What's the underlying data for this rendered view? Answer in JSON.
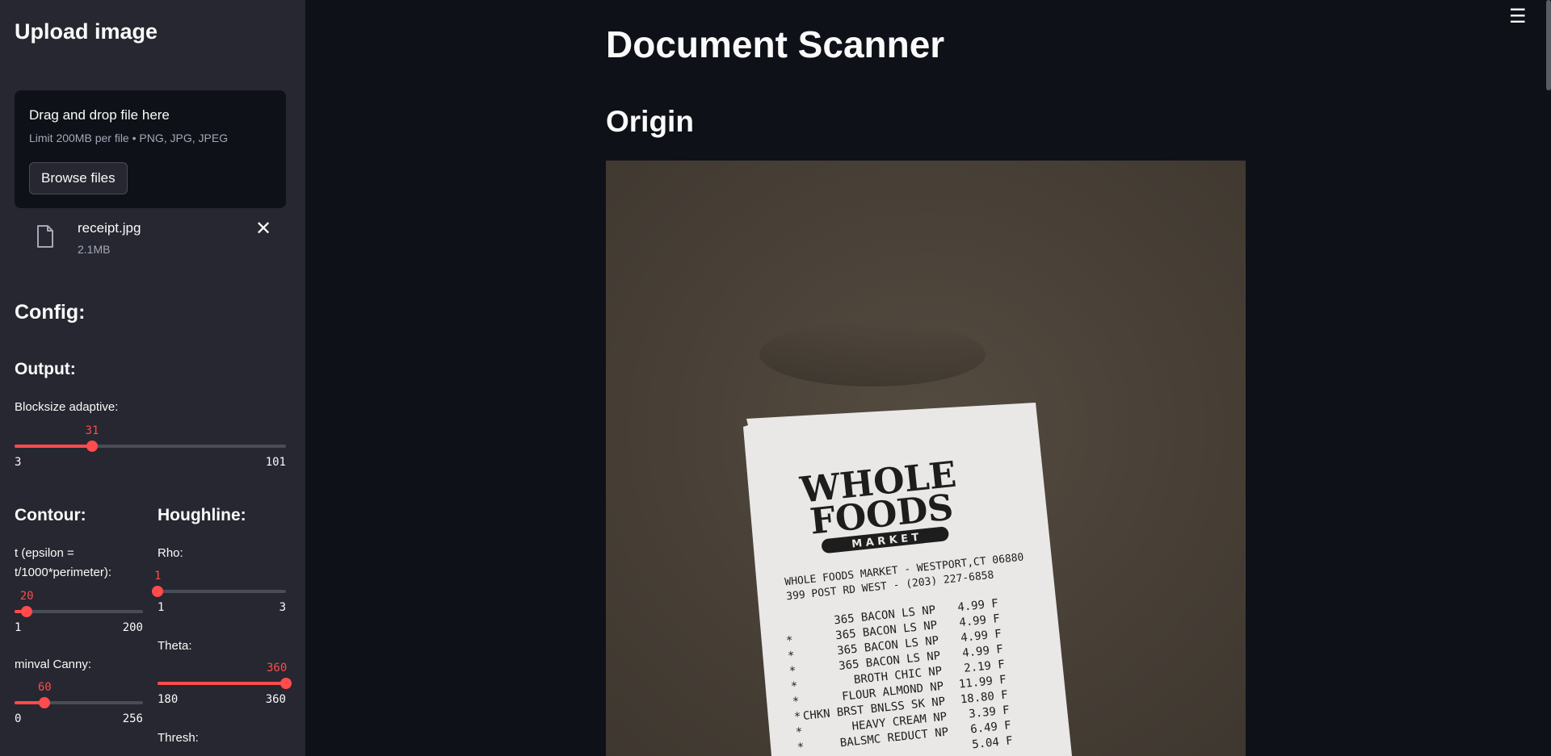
{
  "sidebar": {
    "title": "Upload image",
    "uploader": {
      "drag_text": "Drag and drop file here",
      "limit_text": "Limit 200MB per file • PNG, JPG, JPEG",
      "browse_label": "Browse files"
    },
    "file": {
      "name": "receipt.jpg",
      "size": "2.1MB",
      "close_glyph": "✕"
    },
    "config_heading": "Config:",
    "output": {
      "heading": "Output:",
      "blocksize": {
        "label": "Blocksize adaptive:",
        "value": "31",
        "min": "3",
        "max": "101"
      }
    },
    "contour": {
      "heading": "Contour:",
      "epsilon": {
        "label": "t (epsilon = t/1000*perimeter):",
        "value": "20",
        "min": "1",
        "max": "200"
      },
      "minval": {
        "label": "minval Canny:",
        "value": "60",
        "min": "0",
        "max": "256"
      }
    },
    "houghline": {
      "heading": "Houghline:",
      "rho": {
        "label": "Rho:",
        "value": "1",
        "min": "1",
        "max": "3"
      },
      "theta": {
        "label": "Theta:",
        "value": "360",
        "min": "180",
        "max": "360"
      },
      "thresh": {
        "label": "Thresh:"
      }
    }
  },
  "main": {
    "title": "Document Scanner",
    "section": "Origin",
    "menu_glyph": "☰"
  },
  "receipt": {
    "logo_line1": "WHOLE",
    "logo_line2": "FOODS",
    "logo_line3": "M A R K E T",
    "store_line1": "WHOLE FOODS MARKET - WESTPORT,CT 06880",
    "store_line2": "399 POST RD WEST - (203) 227-6858",
    "items": [
      {
        "mark": "",
        "desc": "365   BACON LS NP",
        "price": "4.99 F"
      },
      {
        "mark": "*",
        "desc": "365   BACON LS NP",
        "price": "4.99 F"
      },
      {
        "mark": "*",
        "desc": "365   BACON LS NP",
        "price": "4.99 F"
      },
      {
        "mark": "*",
        "desc": "365   BACON LS NP",
        "price": "4.99 F"
      },
      {
        "mark": "*",
        "desc": "BROTH CHIC NP",
        "price": "2.19 F"
      },
      {
        "mark": "*",
        "desc": "FLOUR ALMOND NP",
        "price": "11.99 F"
      },
      {
        "mark": "*",
        "desc": "CHKN BRST BNLSS SK NP",
        "price": "18.80 F"
      },
      {
        "mark": "*",
        "desc": "HEAVY CREAM NP",
        "price": "3.39 F"
      },
      {
        "mark": "*",
        "desc": "BALSMC REDUCT NP",
        "price": "6.49 F"
      },
      {
        "mark": "*",
        "desc": "",
        "price": "5.04 F"
      }
    ]
  },
  "sliders": {
    "blocksize": 0.2857,
    "epsilon": 0.0955,
    "minval": 0.2344,
    "rho": 0.0,
    "theta": 1.0
  },
  "colors": {
    "accent": "#ff4b4b",
    "sidebar_bg": "#262730",
    "main_bg": "#0e1117",
    "photo_bg": "#4a4238"
  }
}
